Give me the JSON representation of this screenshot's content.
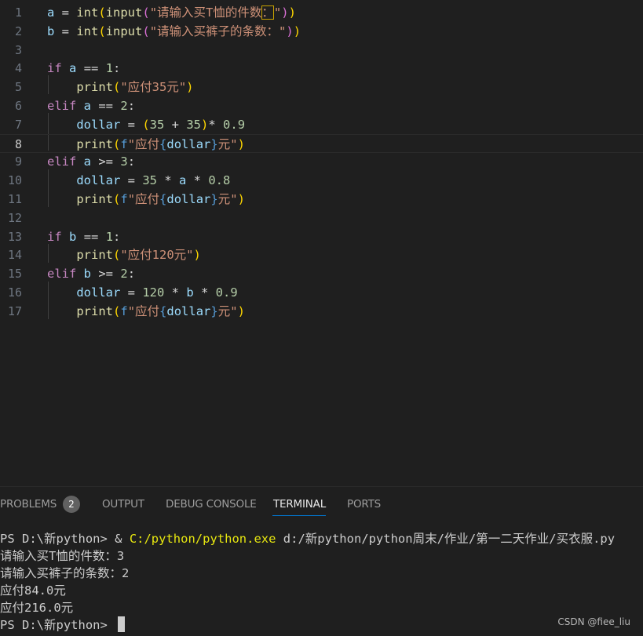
{
  "editor": {
    "line_numbers": [
      "1",
      "2",
      "3",
      "4",
      "5",
      "6",
      "7",
      "8",
      "9",
      "10",
      "11",
      "12",
      "13",
      "14",
      "15",
      "16",
      "17"
    ],
    "current_line": "8",
    "lines": [
      [
        [
          "var",
          "a"
        ],
        [
          "op",
          " = "
        ],
        [
          "fn",
          "int"
        ],
        [
          "b1",
          "("
        ],
        [
          "fn",
          "input"
        ],
        [
          "b2",
          "("
        ],
        [
          "str",
          "\"请输入买T恤的件数"
        ],
        [
          "strbox",
          "："
        ],
        [
          "str",
          "\""
        ],
        [
          "b2",
          ")"
        ],
        [
          "b1",
          ")"
        ]
      ],
      [
        [
          "var",
          "b"
        ],
        [
          "op",
          " = "
        ],
        [
          "fn",
          "int"
        ],
        [
          "b1",
          "("
        ],
        [
          "fn",
          "input"
        ],
        [
          "b2",
          "("
        ],
        [
          "str",
          "\"请输入买裤子的条数：\""
        ],
        [
          "b2",
          ")"
        ],
        [
          "b1",
          ")"
        ]
      ],
      [],
      [
        [
          "kw",
          "if"
        ],
        [
          "op",
          " "
        ],
        [
          "var",
          "a"
        ],
        [
          "op",
          " == "
        ],
        [
          "num",
          "1"
        ],
        [
          "op",
          ":"
        ]
      ],
      [
        [
          "op",
          "    "
        ],
        [
          "fn",
          "print"
        ],
        [
          "b1",
          "("
        ],
        [
          "str",
          "\"应付35元\""
        ],
        [
          "b1",
          ")"
        ]
      ],
      [
        [
          "kw",
          "elif"
        ],
        [
          "op",
          " "
        ],
        [
          "var",
          "a"
        ],
        [
          "op",
          " == "
        ],
        [
          "num",
          "2"
        ],
        [
          "op",
          ":"
        ]
      ],
      [
        [
          "op",
          "    "
        ],
        [
          "var",
          "dollar"
        ],
        [
          "op",
          " = "
        ],
        [
          "b1",
          "("
        ],
        [
          "num",
          "35"
        ],
        [
          "op",
          " + "
        ],
        [
          "num",
          "35"
        ],
        [
          "b1",
          ")"
        ],
        [
          "op",
          "* "
        ],
        [
          "num",
          "0.9"
        ]
      ],
      [
        [
          "op",
          "    "
        ],
        [
          "fn",
          "print"
        ],
        [
          "b1",
          "("
        ],
        [
          "fpre",
          "f"
        ],
        [
          "str",
          "\"应付"
        ],
        [
          "fpre",
          "{"
        ],
        [
          "var",
          "dollar"
        ],
        [
          "fpre",
          "}"
        ],
        [
          "str",
          "元\""
        ],
        [
          "b1",
          ")"
        ]
      ],
      [
        [
          "kw",
          "elif"
        ],
        [
          "op",
          " "
        ],
        [
          "var",
          "a"
        ],
        [
          "op",
          " >= "
        ],
        [
          "num",
          "3"
        ],
        [
          "op",
          ":"
        ]
      ],
      [
        [
          "op",
          "    "
        ],
        [
          "var",
          "dollar"
        ],
        [
          "op",
          " = "
        ],
        [
          "num",
          "35"
        ],
        [
          "op",
          " * "
        ],
        [
          "var",
          "a"
        ],
        [
          "op",
          " * "
        ],
        [
          "num",
          "0.8"
        ]
      ],
      [
        [
          "op",
          "    "
        ],
        [
          "fn",
          "print"
        ],
        [
          "b1",
          "("
        ],
        [
          "fpre",
          "f"
        ],
        [
          "str",
          "\"应付"
        ],
        [
          "fpre",
          "{"
        ],
        [
          "var",
          "dollar"
        ],
        [
          "fpre",
          "}"
        ],
        [
          "str",
          "元\""
        ],
        [
          "b1",
          ")"
        ]
      ],
      [],
      [
        [
          "kw",
          "if"
        ],
        [
          "op",
          " "
        ],
        [
          "var",
          "b"
        ],
        [
          "op",
          " == "
        ],
        [
          "num",
          "1"
        ],
        [
          "op",
          ":"
        ]
      ],
      [
        [
          "op",
          "    "
        ],
        [
          "fn",
          "print"
        ],
        [
          "b1",
          "("
        ],
        [
          "str",
          "\"应付120元\""
        ],
        [
          "b1",
          ")"
        ]
      ],
      [
        [
          "kw",
          "elif"
        ],
        [
          "op",
          " "
        ],
        [
          "var",
          "b"
        ],
        [
          "op",
          " >= "
        ],
        [
          "num",
          "2"
        ],
        [
          "op",
          ":"
        ]
      ],
      [
        [
          "op",
          "    "
        ],
        [
          "var",
          "dollar"
        ],
        [
          "op",
          " = "
        ],
        [
          "num",
          "120"
        ],
        [
          "op",
          " * "
        ],
        [
          "var",
          "b"
        ],
        [
          "op",
          " * "
        ],
        [
          "num",
          "0.9"
        ]
      ],
      [
        [
          "op",
          "    "
        ],
        [
          "fn",
          "print"
        ],
        [
          "b1",
          "("
        ],
        [
          "fpre",
          "f"
        ],
        [
          "str",
          "\"应付"
        ],
        [
          "fpre",
          "{"
        ],
        [
          "var",
          "dollar"
        ],
        [
          "fpre",
          "}"
        ],
        [
          "str",
          "元\""
        ],
        [
          "b1",
          ")"
        ]
      ]
    ]
  },
  "panel": {
    "tabs": {
      "problems": "PROBLEMS",
      "problems_count": "2",
      "output": "OUTPUT",
      "debug_console": "DEBUG CONSOLE",
      "terminal": "TERMINAL",
      "ports": "PORTS"
    },
    "active_tab": "TERMINAL"
  },
  "terminal": {
    "line1_prompt": "PS D:\\新python> & ",
    "line1_exe": "C:/python/python.exe",
    "line1_arg": " d:/新python/python周末/作业/第一二天作业/买衣服.py",
    "line2": "请输入买T恤的件数：3",
    "line3": "请输入买裤子的条数：2",
    "line4": "应付84.0元",
    "line5": "应付216.0元",
    "line6_prompt": "PS D:\\新python> "
  },
  "watermark": "CSDN @fiee_liu",
  "colors": {
    "background": "#1f1f1f",
    "keyword": "#c586c0",
    "function": "#dcdcaa",
    "string": "#ce9178",
    "number": "#b5cea8",
    "variable": "#9cdcfe",
    "tab_active_underline": "#0078d4",
    "terminal_exe": "#e5e510"
  }
}
